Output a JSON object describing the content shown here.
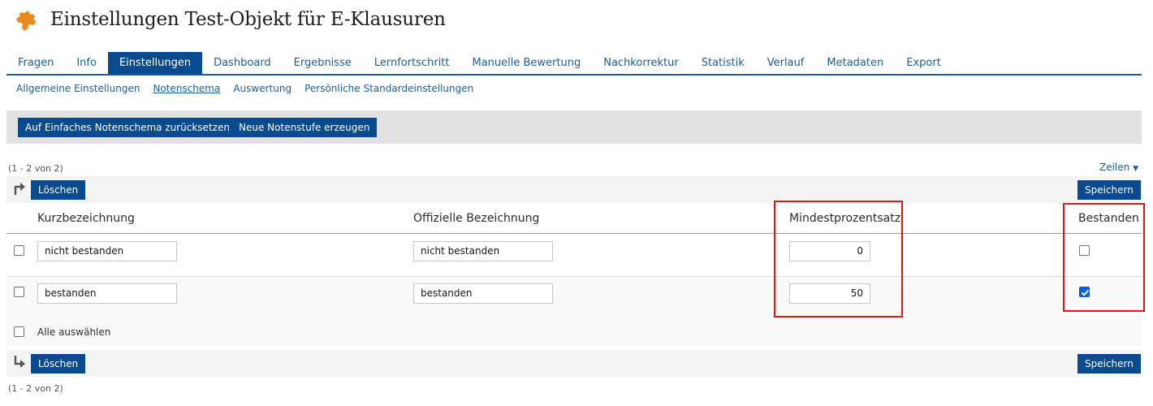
{
  "header": {
    "title": "Einstellungen Test-Objekt für E-Klausuren",
    "logo_color": "#e8891e"
  },
  "tabs": [
    {
      "label": "Fragen",
      "active": false
    },
    {
      "label": "Info",
      "active": false
    },
    {
      "label": "Einstellungen",
      "active": true
    },
    {
      "label": "Dashboard",
      "active": false
    },
    {
      "label": "Ergebnisse",
      "active": false
    },
    {
      "label": "Lernfortschritt",
      "active": false
    },
    {
      "label": "Manuelle Bewertung",
      "active": false
    },
    {
      "label": "Nachkorrektur",
      "active": false
    },
    {
      "label": "Statistik",
      "active": false
    },
    {
      "label": "Verlauf",
      "active": false
    },
    {
      "label": "Metadaten",
      "active": false
    },
    {
      "label": "Export",
      "active": false
    }
  ],
  "subtabs": [
    {
      "label": "Allgemeine Einstellungen",
      "active": false
    },
    {
      "label": "Notenschema",
      "active": true
    },
    {
      "label": "Auswertung",
      "active": false
    },
    {
      "label": "Persönliche Standardeinstellungen",
      "active": false
    }
  ],
  "toolbar": {
    "reset_label": "Auf Einfaches Notenschema zurücksetzen",
    "new_level_label": "Neue Notenstufe erzeugen"
  },
  "table": {
    "count_text": "(1 - 2 von 2)",
    "rows_dropdown_label": "Zeilen",
    "delete_label": "Löschen",
    "save_label": "Speichern",
    "columns": {
      "short": "Kurzbezeichnung",
      "official": "Offizielle Bezeichnung",
      "min_percent": "Mindestprozentsatz",
      "passed": "Bestanden"
    },
    "rows": [
      {
        "short": "nicht bestanden",
        "official": "nicht bestanden",
        "min_percent": "0",
        "passed": false
      },
      {
        "short": "bestanden",
        "official": "bestanden",
        "min_percent": "50",
        "passed": true
      }
    ],
    "select_all_label": "Alle auswählen"
  },
  "colors": {
    "primary": "#0a4a8f",
    "link": "#1c5d99",
    "highlight": "#e0161b",
    "checkbox_checked": "#0a5fd4"
  }
}
